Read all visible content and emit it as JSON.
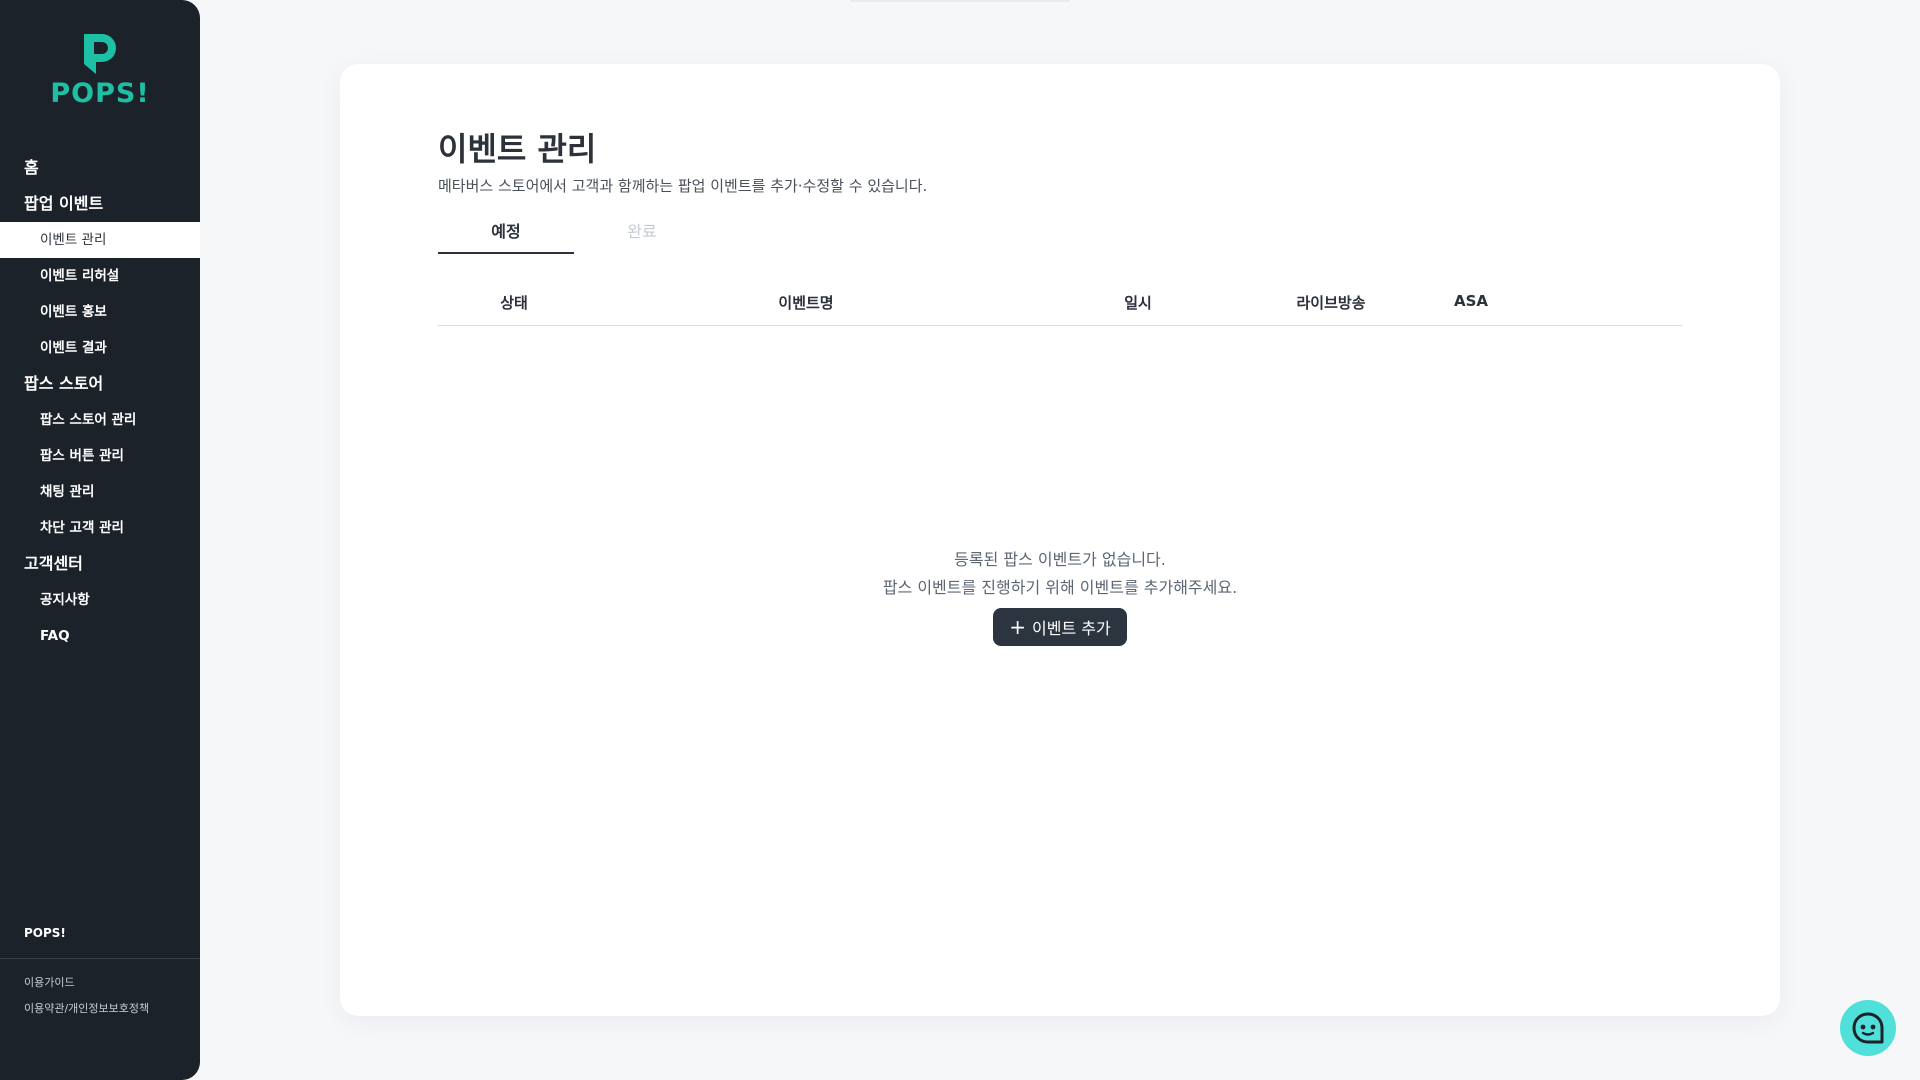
{
  "brand": {
    "name": "POPS!",
    "color": "#1ec0a5"
  },
  "sidebar": {
    "home": "홈",
    "groups": [
      {
        "label": "팝업 이벤트",
        "items": [
          "이벤트 관리",
          "이벤트 리허설",
          "이벤트 홍보",
          "이벤트 결과"
        ]
      },
      {
        "label": "팝스 스토어",
        "items": [
          "팝스 스토어 관리",
          "팝스 버튼 관리",
          "채팅 관리",
          "차단 고객 관리"
        ]
      },
      {
        "label": "고객센터",
        "items": [
          "공지사항",
          "FAQ"
        ]
      }
    ],
    "active_item": "이벤트 관리",
    "footer_brand": "POPS!",
    "footer_links": [
      "이용가이드",
      "이용약관/개인정보보호정책"
    ]
  },
  "main": {
    "title": "이벤트 관리",
    "description": "메타버스 스토어에서 고객과 함께하는 팝업 이벤트를 추가·수정할 수 있습니다.",
    "tabs": [
      {
        "label": "예정",
        "active": true
      },
      {
        "label": "완료",
        "active": false
      }
    ],
    "table_headers": [
      "상태",
      "이벤트명",
      "일시",
      "라이브방송",
      "ASA"
    ],
    "empty_line1": "등록된 팝스 이벤트가 없습니다.",
    "empty_line2": "팝스 이벤트를 진행하기 위해 이벤트를 추가해주세요.",
    "add_button": "이벤트 추가"
  },
  "icons": {
    "add": "plus-icon",
    "chat": "chat-icon",
    "logo": "pops-logo-mark"
  },
  "colors": {
    "sidebar_bg": "#1c222a",
    "button_bg": "#2c3440",
    "chat_bg": "#4fe0da"
  }
}
